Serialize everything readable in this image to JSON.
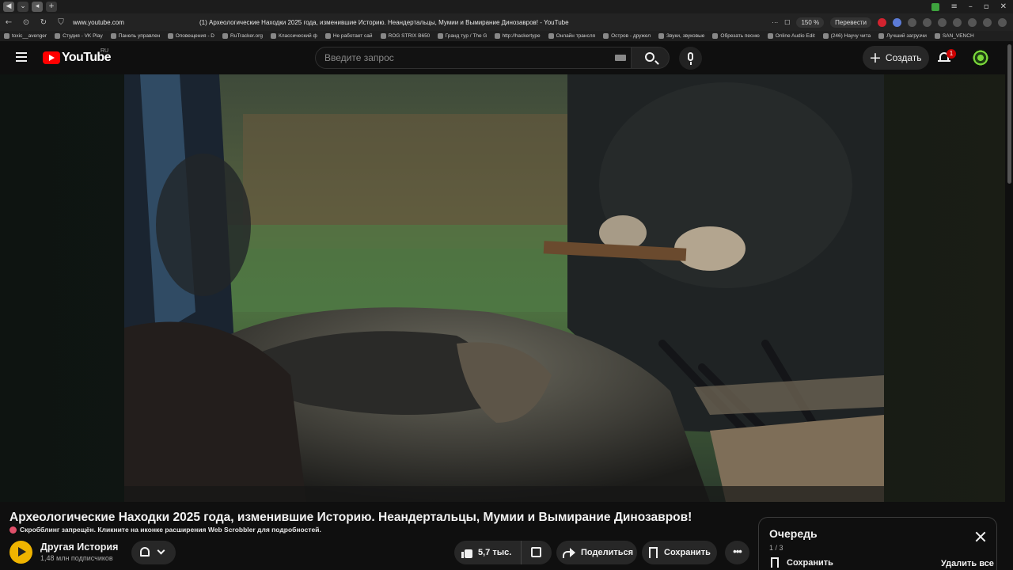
{
  "browser": {
    "url": "www.youtube.com",
    "tab_title": "(1) Археологические Находки 2025 года, изменившие Историю. Неандертальцы, Мумии и Вымирание Динозавров! - YouTube",
    "zoom": "150 %",
    "translate_label": "Перевести",
    "bookmarks": [
      "toxic__avenger",
      "Студия - VK Play",
      "Панель управлен",
      "Оповещения - D",
      "RuTracker.org",
      "Классический ф",
      "Не работает сай",
      "ROG STRIX B650",
      "Гранд тур / The G",
      "http://hackertype",
      "Онлайн трансля",
      "Остров - дружел",
      "Звуки, звуковые",
      "Обрезать песню",
      "Online Audio Edit",
      "(246) Научу чита",
      "Лучший загрузчи",
      "SAN_VENCH"
    ]
  },
  "header": {
    "logo_text": "YouTube",
    "region": "RU",
    "search_placeholder": "Введите запрос",
    "create_label": "Создать",
    "notification_count": "1"
  },
  "video": {
    "title": "Археологические Находки 2025 года, изменившие Историю. Неандертальцы, Мумии и Вымирание Динозавров!",
    "scrobbler_notice": "Скробблинг запрещён. Кликните на иконке расширения Web Scrobbler для подробностей."
  },
  "channel": {
    "name": "Другая История",
    "subscribers": "1,48 млн подписчиков"
  },
  "actions": {
    "likes": "5,7 тыс.",
    "share_label": "Поделиться",
    "save_label": "Сохранить",
    "more_label": "•••"
  },
  "queue": {
    "title": "Очередь",
    "count": "1 / 3",
    "save_label": "Сохранить",
    "clear_label": "Удалить все"
  },
  "colors": {
    "background": "#0f0f0f",
    "accent_red": "#ff0000",
    "pill_bg": "#272727"
  }
}
